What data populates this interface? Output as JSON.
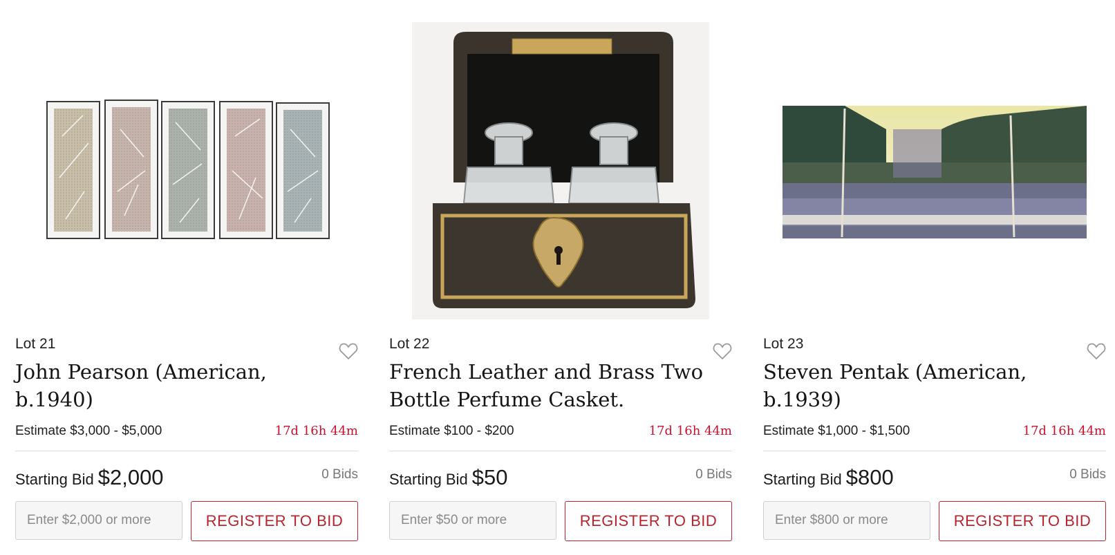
{
  "lots": [
    {
      "lot_label": "Lot 21",
      "title": "John Pearson (American, b.1940)",
      "estimate": "Estimate $3,000 - $5,000",
      "time_left": "17d 16h 44m",
      "starting_bid_label": "Starting Bid",
      "starting_bid": "$2,000",
      "bids": "0 Bids",
      "bid_placeholder": "Enter $2,000 or more",
      "register_label": "REGISTER TO BID"
    },
    {
      "lot_label": "Lot 22",
      "title": "French Leather and Brass Two Bottle Perfume Casket.",
      "estimate": "Estimate $100 - $200",
      "time_left": "17d 16h 44m",
      "starting_bid_label": "Starting Bid",
      "starting_bid": "$50",
      "bids": "0 Bids",
      "bid_placeholder": "Enter $50 or more",
      "register_label": "REGISTER TO BID"
    },
    {
      "lot_label": "Lot 23",
      "title": "Steven Pentak (American, b.1939)",
      "estimate": "Estimate $1,000 - $1,500",
      "time_left": "17d 16h 44m",
      "starting_bid_label": "Starting Bid",
      "starting_bid": "$800",
      "bids": "0 Bids",
      "bid_placeholder": "Enter $800 or more",
      "register_label": "REGISTER TO BID"
    }
  ],
  "icons": {
    "favorite": "heart-outline-icon"
  },
  "colors": {
    "accent": "#b8232d",
    "timer": "#c8102e",
    "divider": "#dcdcdc"
  }
}
